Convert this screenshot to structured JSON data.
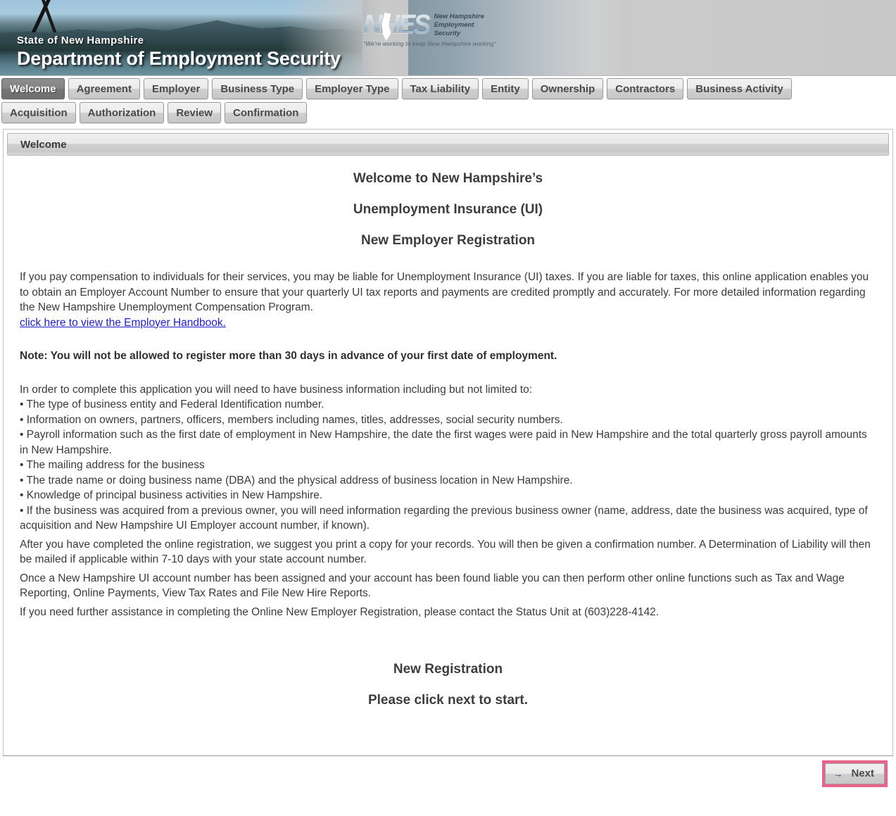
{
  "banner": {
    "state_line": "State of New Hampshire",
    "department_line": "Department of Employment Security",
    "logo": {
      "mark": "NHES",
      "line1": "New Hampshire",
      "line2": "Employment",
      "line3": "Security",
      "tagline": "\"We're working to keep New Hampshire working\""
    }
  },
  "tabs": {
    "row1": [
      {
        "label": "Welcome",
        "active": true
      },
      {
        "label": "Agreement",
        "active": false
      },
      {
        "label": "Employer",
        "active": false
      },
      {
        "label": "Business Type",
        "active": false
      },
      {
        "label": "Employer Type",
        "active": false
      },
      {
        "label": "Tax Liability",
        "active": false
      },
      {
        "label": "Entity",
        "active": false
      },
      {
        "label": "Ownership",
        "active": false
      },
      {
        "label": "Contractors",
        "active": false
      },
      {
        "label": "Business Activity",
        "active": false
      }
    ],
    "row2": [
      {
        "label": "Acquisition",
        "active": false
      },
      {
        "label": "Authorization",
        "active": false
      },
      {
        "label": "Review",
        "active": false
      },
      {
        "label": "Confirmation",
        "active": false
      }
    ]
  },
  "panel": {
    "header": "Welcome",
    "heading1": "Welcome to New Hampshire’s",
    "heading2": "Unemployment Insurance (UI)",
    "heading3": "New Employer Registration",
    "intro_paragraph": "If you pay compensation to individuals for their services, you may be liable for Unemployment Insurance (UI) taxes. If you are liable for taxes, this online application enables you to obtain an Employer Account Number to ensure that your quarterly UI tax reports and payments are credited promptly and accurately. For more detailed information regarding the New Hampshire Unemployment Compensation Program.",
    "handbook_link": "click here to view the Employer Handbook.",
    "note": "Note: You will not be allowed to register more than 30 days in advance of your first date of employment.",
    "requirements_intro": "In order to complete this application you will need to have business information including but not limited to:",
    "requirements": [
      "• The type of business entity and Federal Identification number.",
      "• Information on owners, partners, officers, members including names, titles, addresses, social security numbers.",
      "• Payroll information such as the first date of employment in New Hampshire, the date the first wages were paid in New Hampshire and the total quarterly gross payroll amounts in New Hampshire.",
      "• The mailing address for the business",
      "• The trade name or doing business name (DBA) and the physical address of business location in New Hampshire.",
      "• Knowledge of principal business activities in New Hampshire.",
      "• If the business was acquired from a previous owner, you will need information regarding the previous business owner (name, address, date the business was acquired, type of acquisition and New Hampshire UI Employer account number, if known)."
    ],
    "after_paragraph": "After you have completed the online registration, we suggest you print a copy for your records. You will then be given a confirmation number. A Determination of Liability will then be mailed if applicable within 7-10 days with your state account number.",
    "once_paragraph": "Once a New Hampshire UI account number has been assigned and your account has been found liable you can then perform other online functions such as Tax and Wage Reporting, Online Payments, View Tax Rates and File New Hire Reports.",
    "assistance_paragraph": "If you need further assistance in completing the Online New Employer Registration, please contact the Status Unit at (603)228-4142.",
    "bottom_heading1": "New Registration",
    "bottom_heading2": "Please click next to start."
  },
  "footer": {
    "next_label": "Next",
    "next_arrow": "→",
    "highlight_color": "#e8638c"
  }
}
